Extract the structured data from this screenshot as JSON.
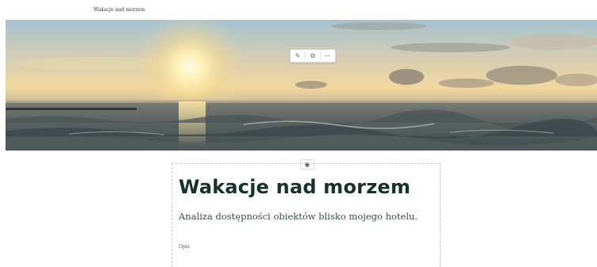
{
  "header": {
    "site_title": "Wakacje nad morzem"
  },
  "hero": {
    "image_name": "sunset-over-sea",
    "toolbar": {
      "edit_icon": "pencil-icon",
      "settings_icon": "gear-icon",
      "more_icon": "more-icon"
    }
  },
  "content": {
    "visibility_icon": "eye-icon",
    "title": "Wakacje nad morzem",
    "subtitle": "Analiza dostępności obiektów blisko mojego hotelu.",
    "description_label": "Opis"
  },
  "colors": {
    "heading": "#16322d",
    "subtitle": "#3a4a4f",
    "dashed_border": "#c9c9c9"
  }
}
